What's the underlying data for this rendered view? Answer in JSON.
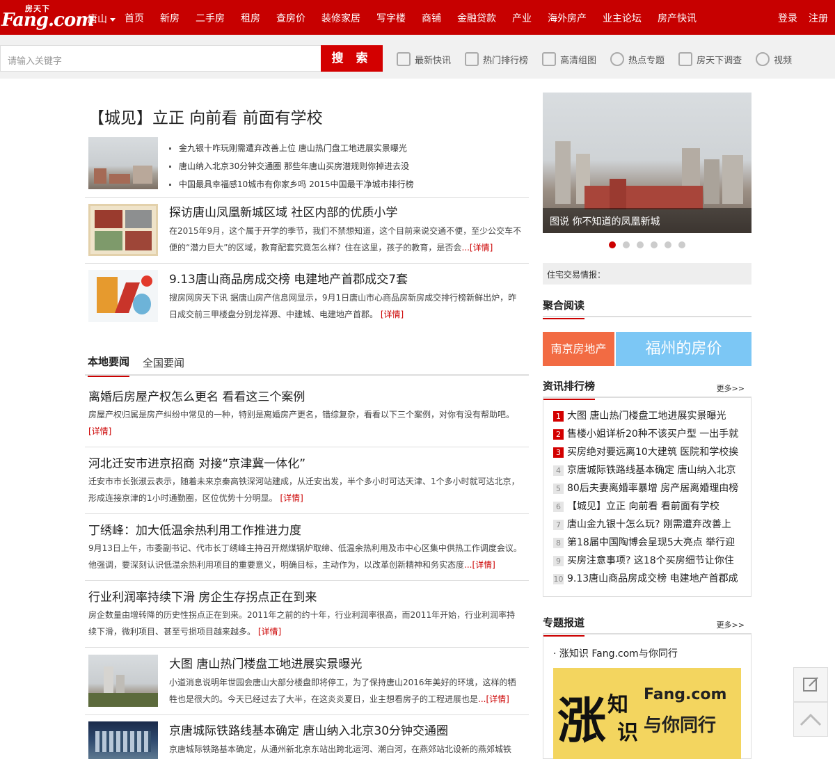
{
  "header": {
    "logo_text": "Fang.com",
    "logo_cn": "房天下",
    "city": "唐山",
    "nav": [
      "首页",
      "新房",
      "二手房",
      "租房",
      "查房价",
      "装修家居",
      "写字楼",
      "商铺",
      "金融贷款",
      "产业",
      "海外房产",
      "业主论坛",
      "房产快讯"
    ],
    "login": "登录",
    "register": "注册"
  },
  "search": {
    "placeholder": "请输入关键字",
    "button": "搜 索",
    "quick_links": [
      "最新快讯",
      "热门排行榜",
      "高清组图",
      "热点专题",
      "房天下调查",
      "视频"
    ]
  },
  "headline": {
    "title": "【城见】立正 向前看 前面有学校",
    "bullets": [
      "金九银十咋玩刚需遭弃改善上位 唐山热门盘工地进展实景曝光",
      "唐山纳入北京30分钟交通圈 那些年唐山买房潜规则你掉进去没",
      "中国最具幸福感10城市有你家乡吗 2015中国最干净城市排行榜"
    ]
  },
  "features": [
    {
      "title": "探访唐山凤凰新城区域 社区内部的优质小学",
      "desc": "在2015年9月，这个属于开学的季节，我们不禁想知道，这个目前来说交通不便，至少公交车不便的“潜力巨大”的区域，教育配套究竟怎么样？住在这里，孩子的教育，是否会",
      "more": "...[详情]"
    },
    {
      "title": "9.13唐山商品房成交榜 电建地产首郡成交7套",
      "desc": "搜房网房天下讯 据唐山房产信息网显示，9月1日唐山市心商品房新房成交排行榜新鲜出炉，昨日成交前三甲楼盘分别龙祥源、中建城、电建地产首郡。",
      "more": "[详情]"
    }
  ],
  "tabs": [
    "本地要闻",
    "全国要闻"
  ],
  "local_news": [
    {
      "title": "离婚后房屋产权怎么更名 看看这三个案例",
      "desc": "房屋产权归属是房产纠纷中常见的一种，特别是离婚房产更名，错综复杂，看看以下三个案例，对你有没有帮助吧。",
      "more": "[详情]"
    },
    {
      "title": "河北迁安市进京招商 对接“京津冀一体化”",
      "desc": "迁安市市长张淑云表示，随着未来京秦高铁深河站建成，从迁安出发，半个多小时可达天津、1个多小时就可达北京，形成连接京津的1小时通勤圈，区位优势十分明显。",
      "more": "[详情]"
    },
    {
      "title": "丁绣峰：加大低温余热利用工作推进力度",
      "desc": "9月13日上午，市委副书记、代市长丁绣峰主持召开燃煤锅炉取缔、低温余热利用及市中心区集中供热工作调度会议。他强调，要深刻认识低温余热利用项目的重要意义，明确目标，主动作为，以改革创新精神和务实态度",
      "more": "...[详情]"
    },
    {
      "title": "行业利润率持续下滑 房企生存拐点正在到来",
      "desc": "房企数量由增转降的历史性拐点正在到来。2011年之前的约十年，行业利润率很高，而2011年开始，行业利润率持续下滑，微利项目、甚至亏损项目越来越多。",
      "more": "[详情]"
    },
    {
      "title": "大图 唐山热门楼盘工地进展实景曝光",
      "desc": "小道消息说明年世园会唐山大部分楼盘即将停工，为了保持唐山2016年美好的环境，这样的牺牲也是很大的。今天已经过去了大半，在这炎炎夏日，业主想看房子的工程进展也是",
      "more": "...[详情]"
    },
    {
      "title": "京唐城际铁路线基本确定 唐山纳入北京30分钟交通圈",
      "desc": "京唐城际铁路基本确定，从通州新北京东站出跨北运河、潮白河，在燕郊站北设新的燕郊城铁"
    }
  ],
  "right": {
    "carousel_caption": "图说  你不知道的凤凰新城",
    "carousel_dots": 6,
    "trade_label": "住宅交易情报：",
    "aggregate_title": "聚合阅读",
    "tile1": "南京房地产",
    "tile2": "福州的房价",
    "ranking_title": "资讯排行榜",
    "more_label": "更多>>",
    "ranking": [
      "大图 唐山热门楼盘工地进展实景曝光",
      "售楼小姐详析20种不该买户型 一出手就",
      "买房绝对要远离10大建筑 医院和学校挨",
      "京唐城际铁路线基本确定 唐山纳入北京",
      "80后夫妻离婚率暴增 房产居离婚理由榜",
      "【城见】立正 向前看 看前面有学校",
      "唐山金九银十怎么玩? 刚需遭弃改善上",
      "第18届中国陶博会呈现5大亮点 举行迎",
      "买房注意事项? 这18个买房细节让你住",
      "9.13唐山商品房成交榜 电建地产首郡成"
    ],
    "special_title": "专题报道",
    "special_item": "涨知识 Fang.com与你同行",
    "promo": {
      "z1": "涨",
      "z2": "知",
      "z3": "识",
      "brand": "Fang.com",
      "slogan": "与你同行"
    }
  },
  "colors": {
    "brand_red": "#c70000",
    "accent": "#d30000",
    "tile_orange": "#f26b43",
    "tile_blue": "#7cc7f5"
  }
}
